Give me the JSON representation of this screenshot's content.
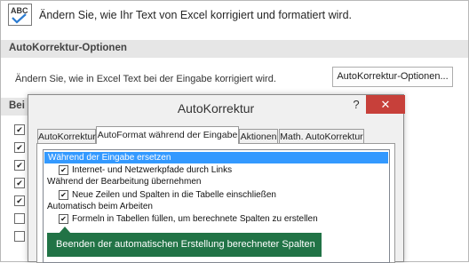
{
  "info": {
    "text": "Ändern Sie, wie Ihr Text von Excel korrigiert und formatiert wird.",
    "icon": "abc-check-icon"
  },
  "autocorrect_section": {
    "header": "AutoKorrektur-Optionen",
    "description": "Ändern Sie, wie in Excel Text bei der Eingabe korrigiert wird.",
    "button_label": "AutoKorrektur-Optionen..."
  },
  "second_section": {
    "header_fragment": "Bei"
  },
  "background_checkboxes": [
    {
      "checked": true
    },
    {
      "checked": true
    },
    {
      "checked": true
    },
    {
      "checked": true
    },
    {
      "checked": true
    },
    {
      "checked": false
    },
    {
      "checked": false
    }
  ],
  "dialog": {
    "title": "AutoKorrektur",
    "help": "?",
    "close": "✕",
    "tabs": [
      {
        "label": "AutoKorrektur",
        "active": false
      },
      {
        "label": "AutoFormat während der Eingabe",
        "active": true
      },
      {
        "label": "Aktionen",
        "active": false
      },
      {
        "label": "Math. AutoKorrektur",
        "active": false
      }
    ],
    "list": {
      "group1": "Während der Eingabe ersetzen",
      "item1": "Internet- und Netzwerkpfade durch Links",
      "group2": "Während der Bearbeitung übernehmen",
      "item2": "Neue Zeilen und Spalten in die Tabelle einschließen",
      "group3": "Automatisch beim Arbeiten",
      "item3": "Formeln in Tabellen füllen, um berechnete Spalten zu erstellen"
    }
  },
  "tooltip": {
    "text": "Beenden der automatischen Erstellung berechneter Spalten",
    "color": "#217346"
  },
  "colors": {
    "selection": "#3399ff",
    "close_button": "#c7403a"
  }
}
